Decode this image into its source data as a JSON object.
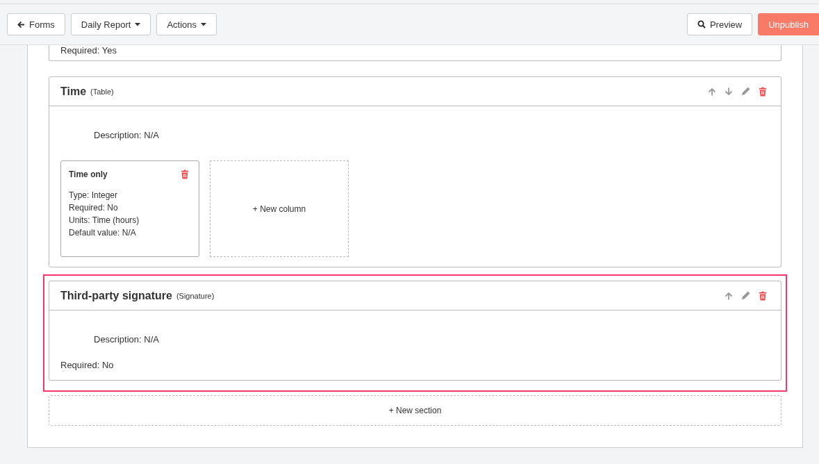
{
  "toolbar": {
    "back_button": "Forms",
    "dropdowns": [
      "Daily Report",
      "Actions"
    ],
    "preview_button": "Preview",
    "unpublish_button": "Unpublish"
  },
  "partial_section": {
    "required": "Required: Yes"
  },
  "sections": [
    {
      "title": "Time",
      "type": "(Table)",
      "can_move_down": true,
      "selected": false,
      "description": "Description: N/A",
      "columns": [
        {
          "title": "Time only",
          "lines": [
            "Type: Integer",
            "Required: No",
            "Units: Time (hours)",
            "Default value: N/A"
          ]
        }
      ],
      "new_column": "+ New column"
    },
    {
      "title": "Third-party signature",
      "type": "(Signature)",
      "can_move_down": false,
      "selected": true,
      "description": "Description: N/A",
      "required": "Required: No"
    }
  ],
  "new_section": "+ New section"
}
